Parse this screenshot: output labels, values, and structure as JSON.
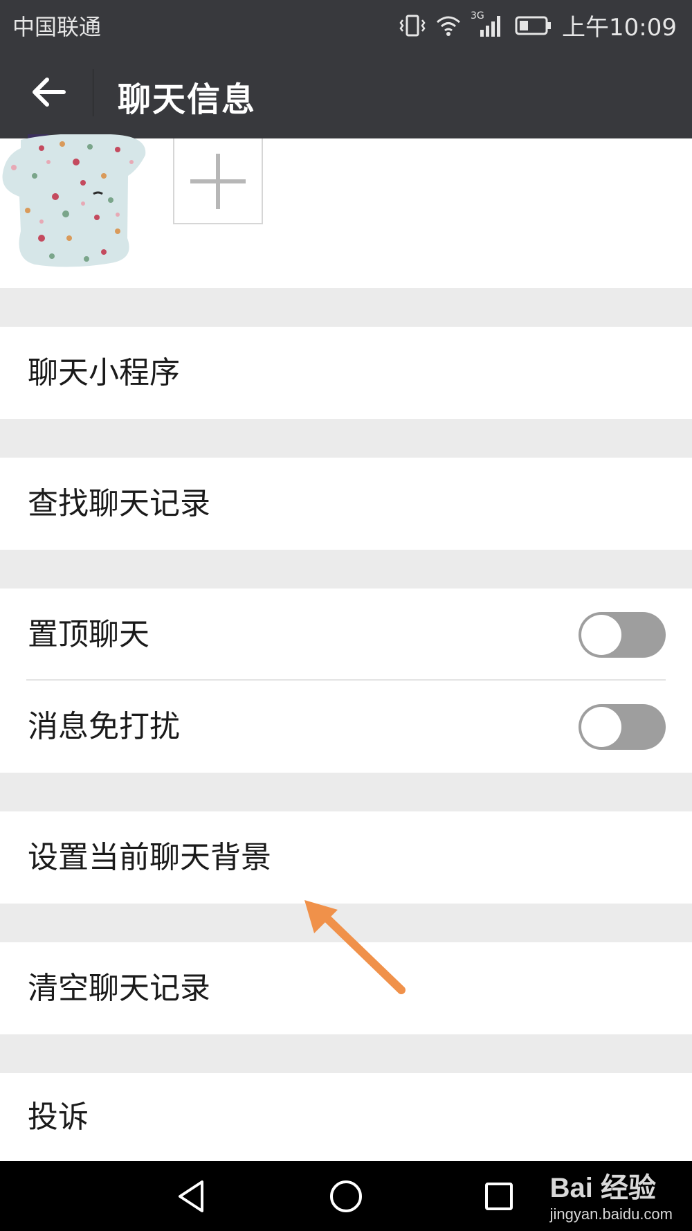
{
  "status_bar": {
    "carrier": "中国联通",
    "network": "3G",
    "time": "上午10:09"
  },
  "header": {
    "title": "聊天信息"
  },
  "menu": {
    "mini_programs": "聊天小程序",
    "search_history": "查找聊天记录",
    "pin_chat": {
      "label": "置顶聊天",
      "on": false
    },
    "mute": {
      "label": "消息免打扰",
      "on": false
    },
    "background": "设置当前聊天背景",
    "clear_history": "清空聊天记录",
    "report": "投诉"
  },
  "watermark": {
    "brand": "Bai 经验",
    "url": "jingyan.baidu.com"
  },
  "colors": {
    "bar": "#38393d",
    "arrow": "#f0914a",
    "toggle_off": "#9e9e9e"
  }
}
